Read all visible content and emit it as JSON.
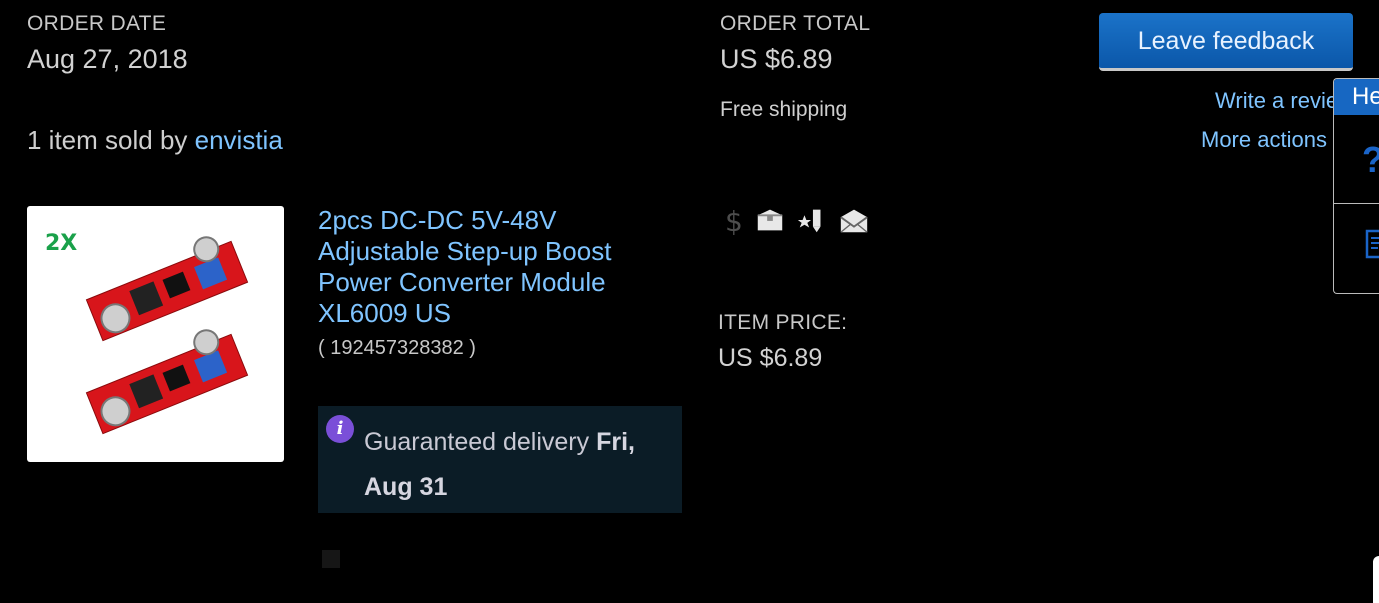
{
  "order": {
    "date_label": "ORDER DATE",
    "date_value": "Aug 27, 2018",
    "total_label": "ORDER TOTAL",
    "total_value": "US $6.89",
    "shipping": "Free shipping",
    "sold_by_prefix": "1 item sold by ",
    "seller": "envistia"
  },
  "item": {
    "title": "2pcs DC-DC 5V-48V Adjustable Step-up Boost Power Converter Module XL6009 US",
    "number": "( 192457328382 )",
    "thumbnail_badge": "2X",
    "price_label": "ITEM PRICE:",
    "price_value": "US $6.89",
    "status_icons": [
      "dollar-icon",
      "package-icon",
      "star-feedback-icon",
      "envelope-icon"
    ]
  },
  "delivery": {
    "info_glyph": "i",
    "prefix": "Guaranteed delivery ",
    "date": "Fri, Aug 31"
  },
  "actions": {
    "feedback_button": "Leave feedback",
    "write_review": "Write a review",
    "more_actions": "More actions"
  },
  "help_panel": {
    "title": "Help",
    "question_glyph": "?"
  },
  "colors": {
    "background": "#000000",
    "link": "#7fc4ff",
    "button": "#0b57a9",
    "info_icon": "#7a4fd8",
    "delivery_box": "#0b1c26"
  }
}
